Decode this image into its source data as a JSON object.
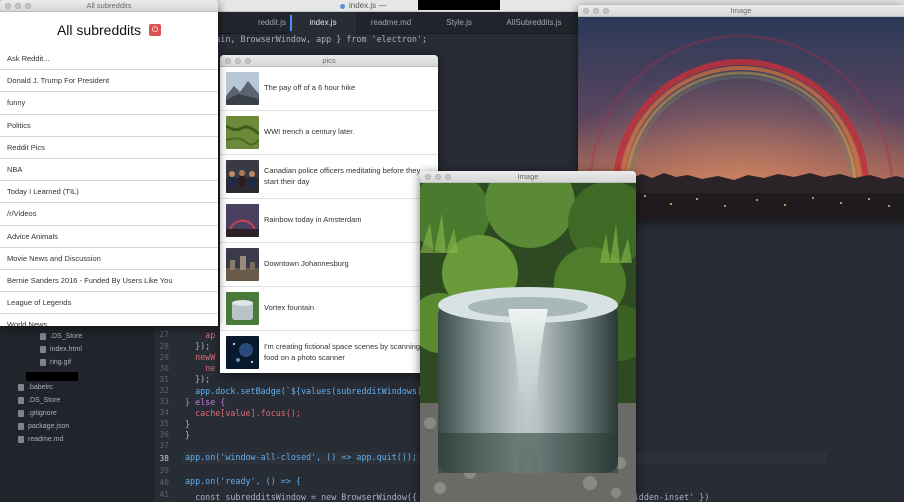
{
  "editor": {
    "title": "index.js —",
    "tabs": [
      {
        "label": "reddit.js"
      },
      {
        "label": "index.js"
      },
      {
        "label": "readme.md"
      },
      {
        "label": "Style.js"
      },
      {
        "label": "AllSubreddits.js"
      }
    ],
    "top_code": "{ ipcMain, BrowserWindow, app } from 'electron';",
    "line_numbers": [
      "27",
      "28",
      "29",
      "30",
      "31",
      "32",
      "33",
      "34",
      "35",
      "36",
      "37",
      "38",
      "39",
      "40",
      "41"
    ],
    "code_lines": [
      "    ap",
      "  });",
      "  newW",
      "    ne",
      "  });",
      "  app.dock.setBadge(`${values(subredditWindows).co",
      "} else {",
      "  cache[value].focus();",
      "}",
      "}",
      "",
      "app.on('window-all-closed', () => app.quit());",
      "",
      "app.on('ready', () => {",
      "  const subredditsWindow = new BrowserWindow({ width: 450, height: 550, titleBarStyle: 'hidden-inset' })"
    ],
    "tree": [
      {
        "name": ".DS_Store"
      },
      {
        "name": "index.html"
      },
      {
        "name": "ring.gif"
      },
      {
        "name": ".babelrc"
      },
      {
        "name": ".DS_Store"
      },
      {
        "name": ".gitignore"
      },
      {
        "name": "package.json"
      },
      {
        "name": "readme.md"
      }
    ]
  },
  "subreddits_window": {
    "window_title": "All subreddits",
    "heading": "All subreddits",
    "power_icon": "power-icon",
    "items": [
      {
        "label": "Ask Reddit..."
      },
      {
        "label": "Donald J. Trump For President"
      },
      {
        "label": "funny"
      },
      {
        "label": "Politics"
      },
      {
        "label": "Reddit Pics"
      },
      {
        "label": "NBA"
      },
      {
        "label": "Today I Learned (TIL)"
      },
      {
        "label": "/r/Videos"
      },
      {
        "label": "Advice Animals"
      },
      {
        "label": "Movie News and Discussion"
      },
      {
        "label": "Bernie Sanders 2016 - Funded By Users Like You"
      },
      {
        "label": "League of Legends"
      },
      {
        "label": "World News"
      }
    ]
  },
  "pics_window": {
    "window_title": "pics",
    "items": [
      {
        "title": "The pay off of a 6 hour hike",
        "thumb": "mountain-thumb"
      },
      {
        "title": "WWI trench a century later.",
        "thumb": "trench-thumb"
      },
      {
        "title": "Canadian police officers meditating before they start their day",
        "thumb": "police-thumb"
      },
      {
        "title": "Rainbow today in Amsterdam",
        "thumb": "rainbow-thumb"
      },
      {
        "title": "Downtown Johannesburg",
        "thumb": "city-thumb"
      },
      {
        "title": "Vortex fountain",
        "thumb": "fountain-thumb"
      },
      {
        "title": "I'm creating fictional space scenes by scanning food on a photo scanner",
        "thumb": "space-thumb"
      }
    ]
  },
  "image_windows": [
    {
      "window_title": "Image",
      "subject": "rainbow-over-amsterdam"
    },
    {
      "window_title": "Image",
      "subject": "vortex-fountain"
    }
  ]
}
